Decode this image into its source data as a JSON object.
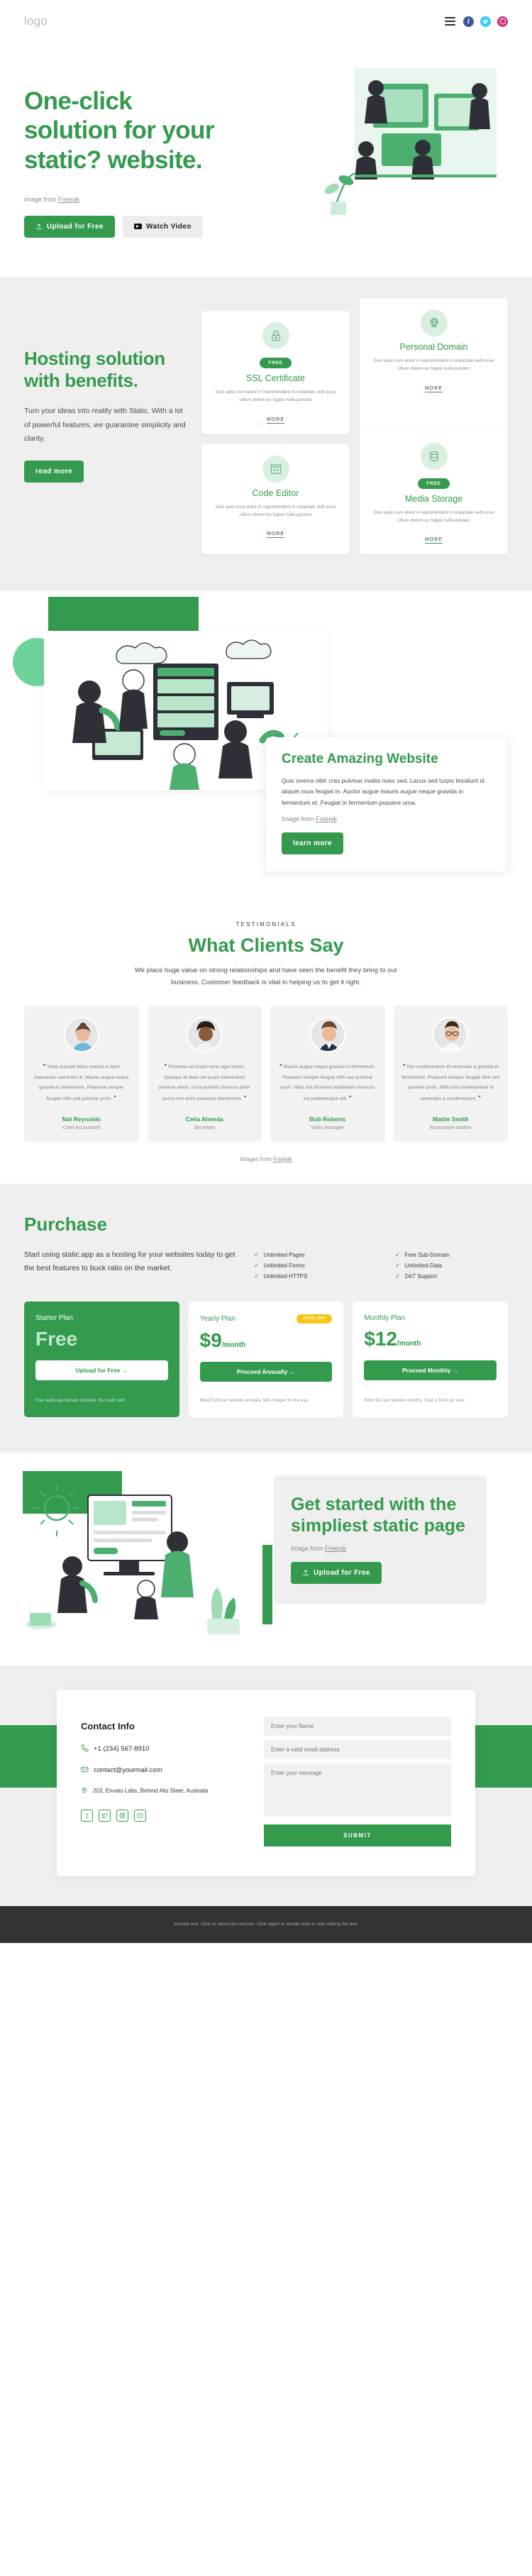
{
  "header": {
    "logo": "logo",
    "menu_label": "menu",
    "socials": [
      {
        "name": "facebook",
        "glyph": "f"
      },
      {
        "name": "twitter",
        "glyph": "t"
      },
      {
        "name": "instagram",
        "glyph": ""
      }
    ]
  },
  "hero": {
    "title": "One-click solution for your static? website.",
    "credit_prefix": "Image from ",
    "credit_link": "Freepik",
    "primary_btn": "Upload for Free",
    "secondary_btn": "Watch Video"
  },
  "benefits": {
    "title": "Hosting solution with benefits.",
    "description": "Turn your ideas into reality with Static. With a lot of powerful features, we guarantee simplicity and clarity.",
    "button": "read more",
    "cards": [
      {
        "icon": "lock-icon",
        "badge": "FREE",
        "title": "SSL Certificate",
        "text": "Duis aute irure dolor in reprehenderit in voluptate velit esse cillum dolore eu fugiat nulla pariatur",
        "more": "MORE"
      },
      {
        "icon": "globe-icon",
        "badge": "",
        "title": "Personal Domain",
        "text": "Duis aute irure dolor in reprehenderit in voluptate velit esse cillum dolore eu fugiat nulla pariatur",
        "more": "MORE"
      },
      {
        "icon": "code-icon",
        "badge": "",
        "title": "Code Editor",
        "text": "Duis aute irure dolor in reprehenderit in voluptate velit esse cillum dolore eu fugiat nulla pariatur",
        "more": "MORE"
      },
      {
        "icon": "database-icon",
        "badge": "FREE",
        "title": "Media Storage",
        "text": "Duis aute irure dolor in reprehenderit in voluptate velit esse cillum dolore eu fugiat nulla pariatur",
        "more": "MORE"
      }
    ]
  },
  "create": {
    "title": "Create Amazing Website",
    "body": "Quis viverra nibh cras pulvinar mattis nunc sed. Lacus sed turpis tincidunt id aliquet risus feugiat in. Auctor augue mauris augue neque gravida in fermentum et. Feugiat in fermentum posuere urna.",
    "credit_prefix": "Image from ",
    "credit_link": "Freepik",
    "button": "learn more"
  },
  "testimonials": {
    "eyebrow": "TESTIMONIALS",
    "title": "What Clients Say",
    "subtitle": "We place huge value on strong relationships and have seen the benefit they bring to our business. Customer feedback is vital in helping us to get it right.",
    "credit_prefix": "Images from ",
    "credit_link": "Freepik",
    "items": [
      {
        "quote": "Vitae suscipit tellus mauris a diam maecenas sed enim ut. Mauris augue neque gravida in fermentum. Praesent semper feugiat nibh sed pulvinar proin.",
        "name": "Nat Reynolds",
        "role": "Chief Accountant"
      },
      {
        "quote": "Pharetra vel turpis nunc eget lorem. Quisque id diam vel quam elementum pulvinar etiam. Urna porttitor rhoncus dolor purus non enim praesent elementum.",
        "name": "Celia Almeda",
        "role": "Secretary"
      },
      {
        "quote": "Mauris augue neque gravida in fermentum. Praesent semper feugiat nibh sed pulvinar proin. Nibh nisl dictumst vestibulum rhoncus est pellentesque elit.",
        "name": "Bob Roberts",
        "role": "Sales Manager"
      },
      {
        "quote": "Nisl condimentum id venenatis a gravida in fermentum. Praesent semper feugiat nibh sed pulvinar proin. Nibh nisl condimentum id venenatis a condimentum.",
        "name": "Mattie Smith",
        "role": "Accountant-auditor"
      }
    ]
  },
  "purchase": {
    "title": "Purchase",
    "description": "Start using static.app as a hosting for your websites today to get the best features to buck ratio on the market.",
    "features": [
      "Unlimited Pages",
      "Free Sub-Domain",
      "Unlimited Forms",
      "Unlimited Data",
      "Unlimited HTTPS",
      "24/7 Support"
    ],
    "plans": [
      {
        "name": "Starter Plan",
        "badge": "",
        "price": "Free",
        "per": "",
        "button": "Upload for Free →",
        "note": "Free static.app domain included. No credit card"
      },
      {
        "name": "Yearly Plan",
        "badge": "SAVE 25%",
        "price": "$9",
        "per": "/month",
        "button": "Proceed Annually →",
        "note": "Billed $108 per website annually. $36 cheaper to this way."
      },
      {
        "name": "Monthly Plan",
        "badge": "",
        "price": "$12",
        "per": "/month",
        "button": "Proceed Monthly →",
        "note": "Billed $12 per website monthly. Total is $144 per year."
      }
    ]
  },
  "get_started": {
    "title": "Get started with the simpliest static page",
    "credit_prefix": "Image from ",
    "credit_link": "Freepik",
    "button": "Upload for Free"
  },
  "contact": {
    "heading": "Contact Info",
    "phone": "+1 (234) 567-8910",
    "email": "contact@yourmail.com",
    "address": "203, Envato Labs, Behind Alis Steet, Australia",
    "socials": [
      "facebook",
      "twitter",
      "instagram",
      "youtube"
    ],
    "form": {
      "name_placeholder": "Enter your Name",
      "email_placeholder": "Enter a valid email address",
      "message_placeholder": "Enter your message",
      "submit": "SUBMIT"
    }
  },
  "footer": {
    "text": "Sample text. Click to select the text box. Click again or double click to start editing the text."
  }
}
